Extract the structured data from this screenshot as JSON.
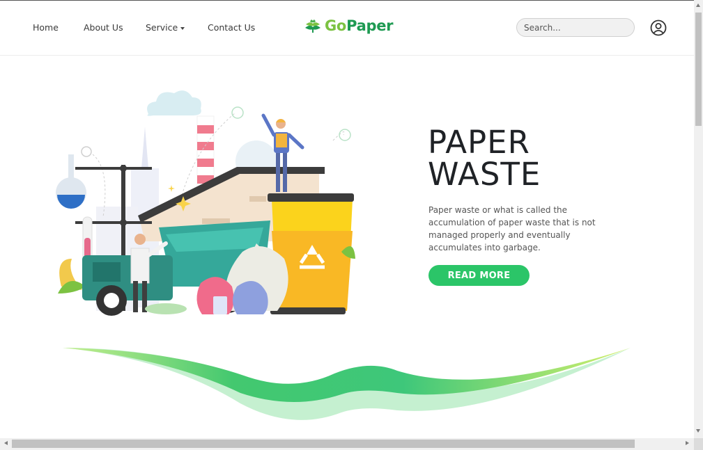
{
  "nav": {
    "home_label": "Home",
    "about_label": "About Us",
    "service_label": "Service",
    "contact_label": "Contact Us"
  },
  "brand": {
    "prefix": "Go",
    "suffix": "Paper",
    "icon": "leaf-stack-icon",
    "colors": {
      "go": "#7cc242",
      "paper": "#1e9a52"
    }
  },
  "search": {
    "placeholder": "Search..."
  },
  "user": {
    "icon": "user-circle-icon"
  },
  "hero": {
    "title_line1": "PAPER",
    "title_line2": "WASTE",
    "description": "Paper waste or what is called the accumulation of paper waste that is not managed properly and eventually accumulates into garbage.",
    "button_label": "READ MORE",
    "accent_color": "#2bc568"
  }
}
